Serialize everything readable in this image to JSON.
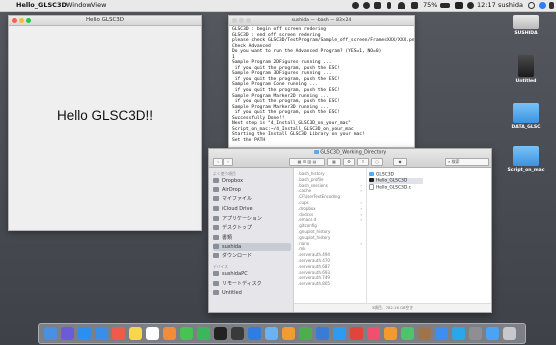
{
  "menubar": {
    "app_name": "Hello_GLSC3D",
    "items": [
      "Window",
      "View"
    ],
    "right": {
      "battery": "75%",
      "time": "12:17",
      "user": "sushida"
    }
  },
  "gl_window": {
    "title": "Hello GLSC3D",
    "content_text": "Hello GLSC3D!!"
  },
  "terminal": {
    "title": "sushida — -bash — 83×24",
    "lines": [
      "GLSC3D : begin off screen redering",
      "GLSC3D : end off screen redering",
      "please check GLSC3D/TestProgram/Sample_off_screen/FramesXXX/XXX.png",
      "Check Advanced",
      "Do you want to run the Advanced Program? (YES=1, NO=0)",
      "1",
      "Sample Program 2DFigures running ...",
      " if you quit the program, push the ESC!",
      "Sample Program 3DFigures running ...",
      " if you quit the program, push the ESC!",
      "Sample Program Cone running ...",
      " if you quit the program, push the ESC!",
      "Sample Program Marker2D running ...",
      " if you quit the program, push the ESC!",
      "Sample Program Marker3D running ...",
      " if you quit the program, push the ESC!",
      "Successfully Done!!",
      "Next step is \"4_Install_GLSC3D_on_your_mac\"",
      "Script_on_mac:~/4_Install_GLSC3D_on_your_mac",
      "Starting the Install GLSC3D Library on your mac!",
      "Set the PATH"
    ]
  },
  "finder": {
    "title": "GLSC3D_Working_Directory",
    "search_placeholder": "検索",
    "sidebar": {
      "favorites_heading": "よく使う項目",
      "favorites": [
        "Dropbox",
        "AirDrop",
        "マイファイル",
        "iCloud Drive",
        "アプリケーション",
        "デスクトップ",
        "書類",
        "sushida",
        "ダウンロード"
      ],
      "devices_heading": "デバイス",
      "devices": [
        "sushidaPC",
        "リモートディスク",
        "Untitled"
      ]
    },
    "column1": [
      ".bash_history",
      ".bash_profile",
      ".bash_sessions",
      ".cache",
      ".CFUserTextEncoding",
      ".cups",
      ".dropbox",
      ".dvdcss",
      ".emacs.d",
      ".gitconfig",
      ".gnuplot_history",
      ".gnuplot_history",
      ".nano",
      ".mk",
      ".serverauth.494",
      ".serverauth.470",
      ".serverauth.687",
      ".serverauth.693",
      ".serverauth.749",
      ".serverauth.805"
    ],
    "column1_has_arrow": [
      false,
      false,
      true,
      true,
      false,
      true,
      true,
      true,
      true,
      false,
      false,
      false,
      true,
      false,
      false,
      false,
      false,
      false,
      false,
      false
    ],
    "column2": [
      "GLSC3D",
      "Hello_GLSC3D",
      "Hello_GLSC3D.c"
    ],
    "status": "3項目、782.16 GB空き"
  },
  "desktop_icons": [
    "SUSHIDA",
    "Untitled",
    "DATA_GLSC",
    "Script_on_mac"
  ],
  "dock_apps": [
    "Finder",
    "Siri",
    "Safari",
    "Mail",
    "Calendar",
    "Notes",
    "Reminders",
    "Photos",
    "Messages",
    "FaceTime",
    "Terminal",
    "Activity",
    "Xcode",
    "Preview",
    "Pages",
    "Numbers",
    "Keynote",
    "App Store",
    "Chrome",
    "iTunes",
    "iBooks",
    "Maps",
    "Contacts",
    "Dropbox",
    "Skype",
    "Settings",
    "Downloads",
    "Trash"
  ]
}
